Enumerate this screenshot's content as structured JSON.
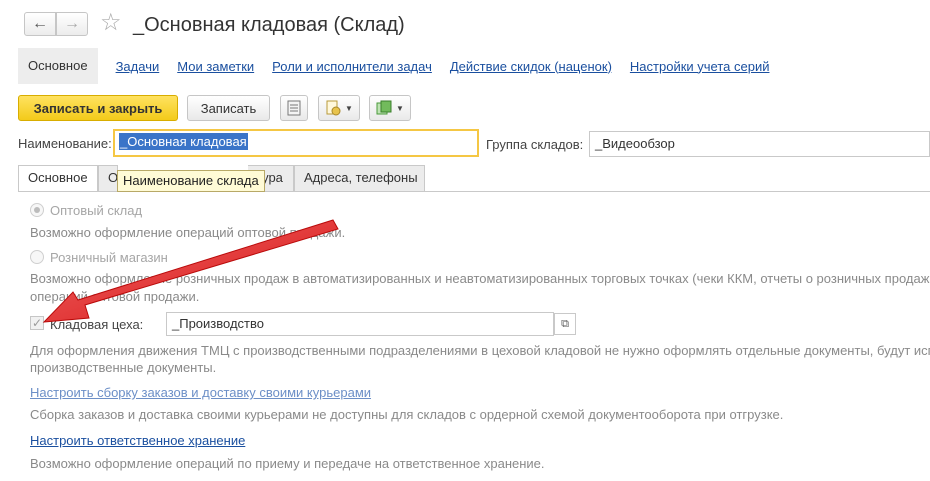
{
  "window": {
    "title": "_Основная кладовая (Склад)",
    "back_icon": "arrow-left-icon",
    "forward_icon": "arrow-right-icon",
    "favorite_icon": "star-icon"
  },
  "nav": {
    "active": "Основное",
    "links": [
      "Задачи",
      "Мои заметки",
      "Роли и исполнители задач",
      "Действие скидок (наценок)",
      "Настройки учета серий"
    ]
  },
  "toolbar": {
    "save_close_label": "Записать и закрыть",
    "save_label": "Записать",
    "list_icon": "list-icon",
    "doc_icon": "document-settings-icon",
    "green_icon": "report-icon"
  },
  "form": {
    "name_label": "Наименование:",
    "name_value": "_Основная кладовая",
    "group_label": "Группа складов:",
    "group_value": "_Видеообзор",
    "tooltip": "Наименование склада"
  },
  "tabs": [
    "Основное",
    "О",
    "тура",
    "Адреса, телефоны"
  ],
  "content": {
    "wholesale_label": "Оптовый склад",
    "wholesale_hint": "Возможно оформление операций оптовой продажи.",
    "retail_label": "Розничный магазин",
    "retail_hint_1": "Возможно оформление розничных продаж в автоматизированных и неавтоматизированных торговых точках (чеки ККМ, отчеты о розничных продажа",
    "retail_hint_2": "операций оптовой продажи.",
    "workshop_label": "Кладовая цеха:",
    "workshop_value": "_Производство",
    "workshop_hint_1": "Для оформления движения ТМЦ с производственными подразделениями в цеховой кладовой не нужно оформлять отдельные документы, будут исп",
    "workshop_hint_2": "производственные документы.",
    "orders_link": "Настроить сборку заказов и доставку своими курьерами",
    "orders_hint": "Сборка заказов и доставка своими курьерами не доступны для складов с ордерной схемой документооборота при отгрузке.",
    "storage_link": "Настроить ответственное хранение",
    "storage_hint": "Возможно оформление операций по приему и передаче на ответственное хранение."
  },
  "colors": {
    "accent_link": "#1a4f9f",
    "primary_button": "#f3cb1a",
    "annotation_arrow": "#e4100f"
  }
}
